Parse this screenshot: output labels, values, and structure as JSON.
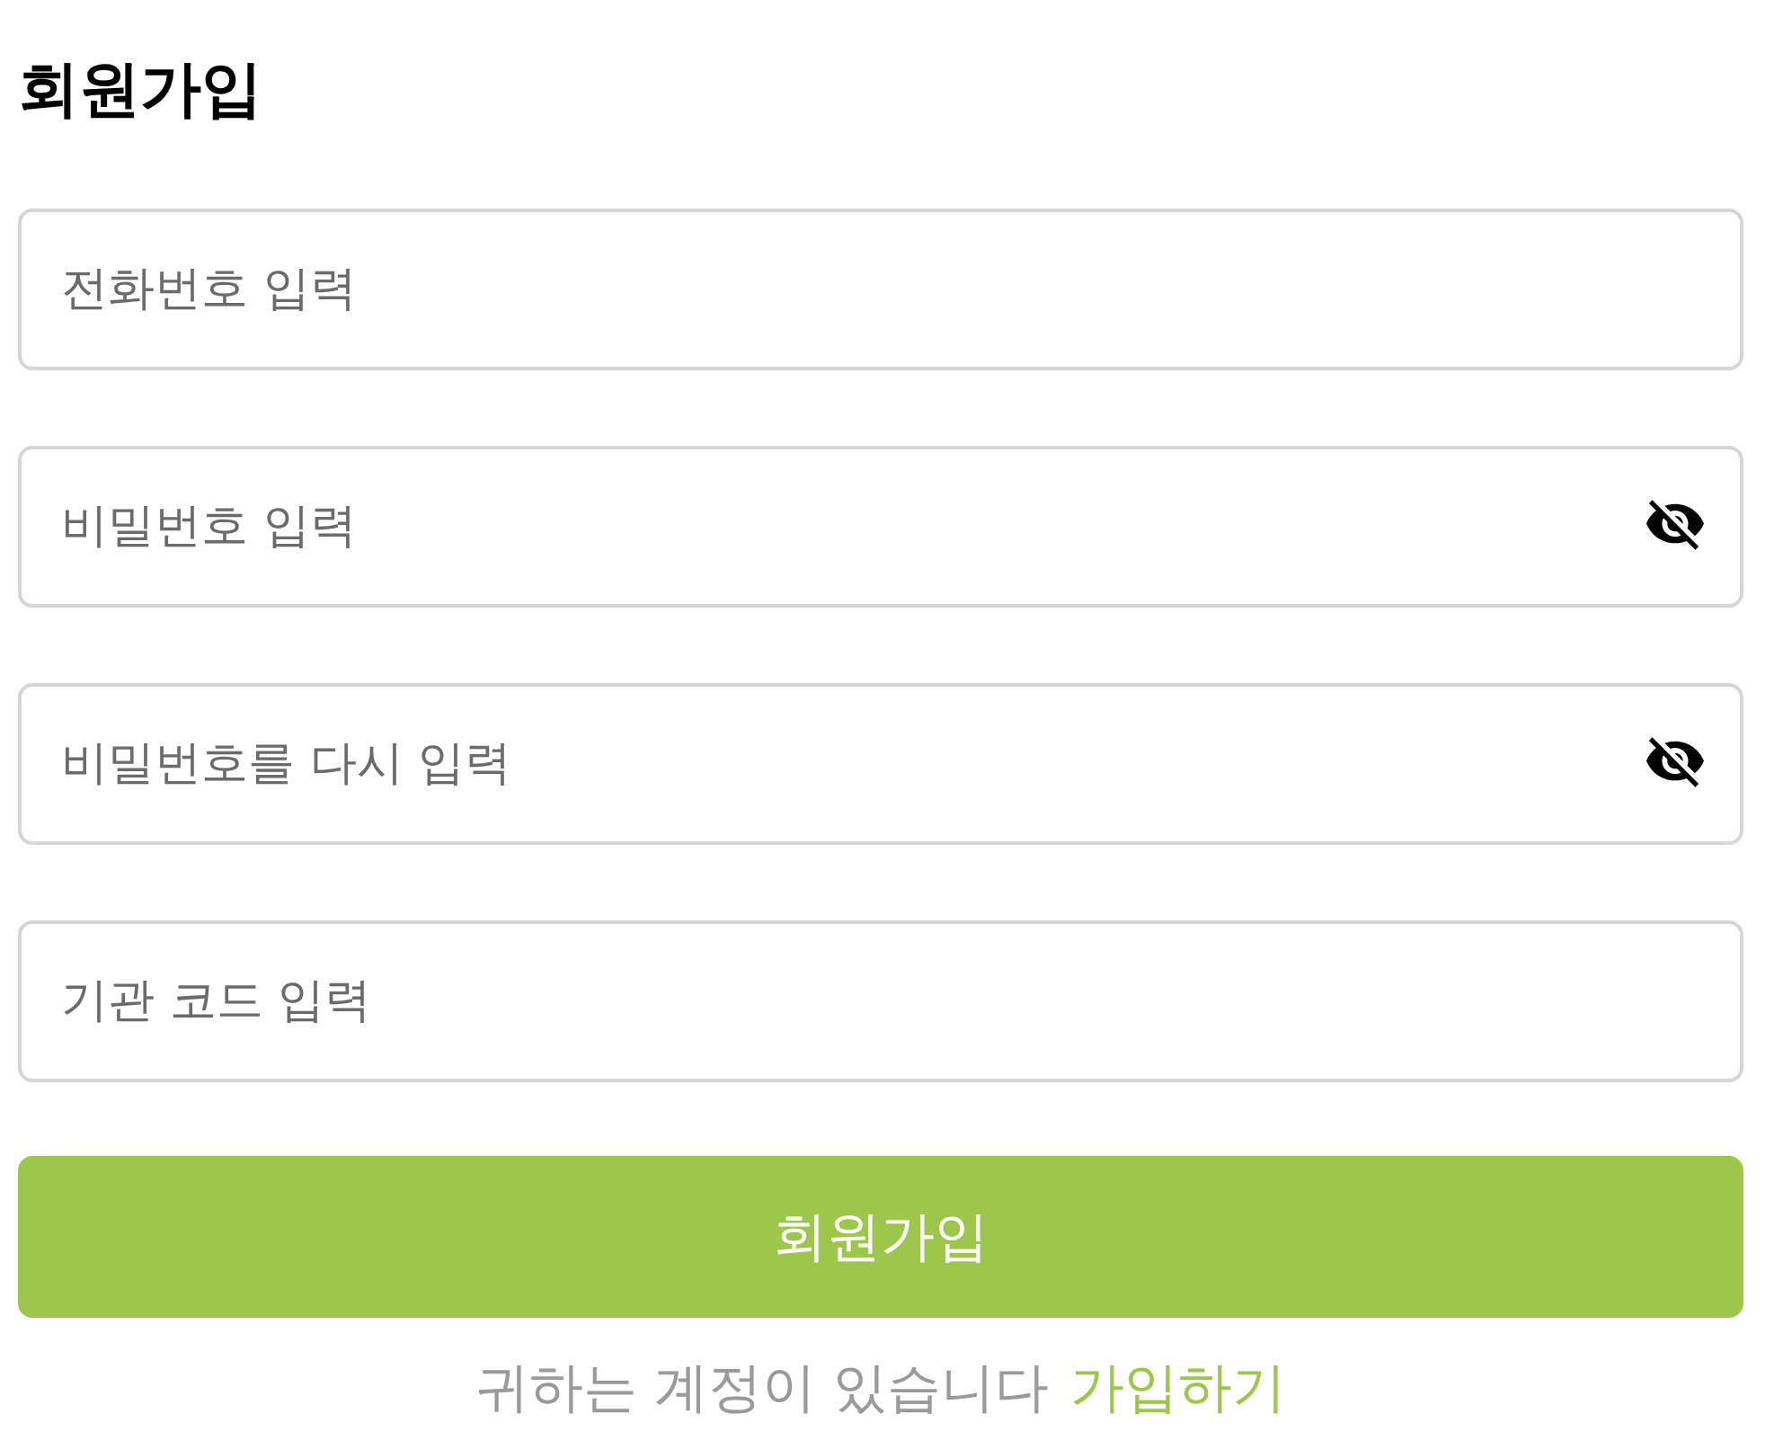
{
  "title": "회원가입",
  "fields": [
    {
      "kind": "text",
      "placeholder": "전화번호 입력"
    },
    {
      "kind": "password",
      "placeholder": "비밀번호 입력"
    },
    {
      "kind": "password",
      "placeholder": "비밀번호를 다시 입력"
    },
    {
      "kind": "text",
      "placeholder": "기관 코드 입력"
    }
  ],
  "submit_button": {
    "label": "회원가입"
  },
  "footer": {
    "text": "귀하는 계정이 있습니다",
    "link": "가입하기"
  }
}
